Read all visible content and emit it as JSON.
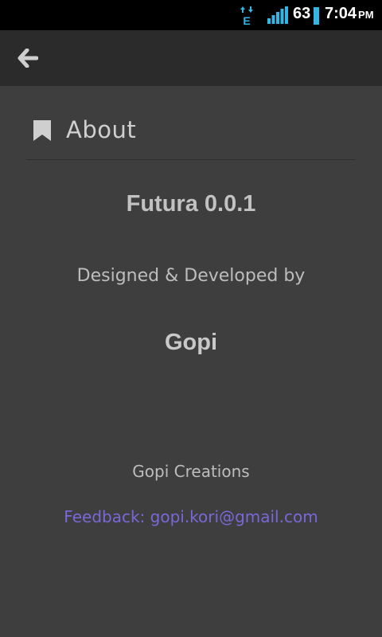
{
  "status_bar": {
    "network_type": "E",
    "battery_level": "63",
    "time": "7:04",
    "time_suffix": "PM",
    "colors": {
      "accent": "#33b5e5",
      "background": "#000000"
    },
    "icons": [
      "data-transfer-icon",
      "signal-strength-icon",
      "battery-icon"
    ]
  },
  "action_bar": {
    "back_icon": "arrow-left-icon"
  },
  "section": {
    "icon": "bookmark-icon",
    "title": "About"
  },
  "about": {
    "app_name": "Futura 0.0.1",
    "credit_line": "Designed & Developed by",
    "author": "Gopi",
    "company": "Gopi Creations",
    "feedback_link": "Feedback: gopi.kori@gmail.com"
  },
  "colors": {
    "background": "#3e3e3e",
    "action_bar": "#2b2b2b",
    "link": "#7a67d8"
  }
}
